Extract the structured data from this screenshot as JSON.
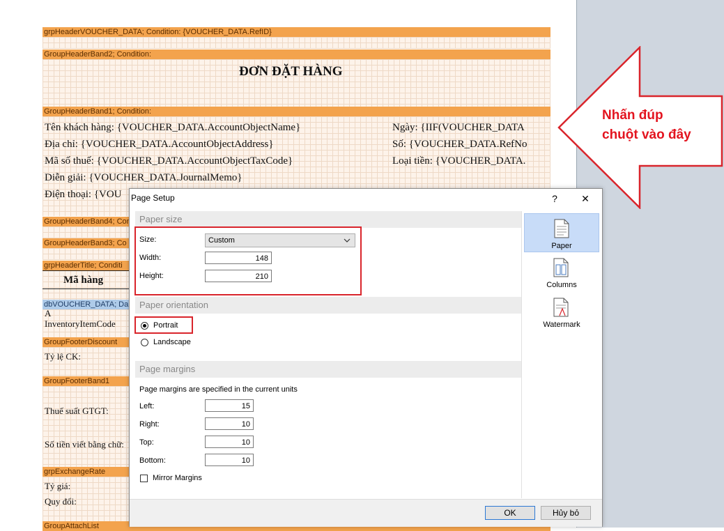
{
  "designer": {
    "bands": {
      "grp_header_voucher": "grpHeaderVOUCHER_DATA; Condition: {VOUCHER_DATA.RefID}",
      "group_header_band2": "GroupHeaderBand2; Condition:",
      "group_header_band1": "GroupHeaderBand1; Condition:",
      "group_header_band4": "GroupHeaderBand4; Cond",
      "group_header_band3": "GroupHeaderBand3; Co",
      "grp_header_title": "grpHeaderTitle; Conditi",
      "db_voucher_data": "dbVOUCHER_DATA; Da",
      "group_footer_discount": "GroupFooterDiscount",
      "group_footer_band1": "GroupFooterBand1",
      "grp_exchange_rate": "grpExchangeRate",
      "group_attach_list": "GroupAttachList"
    },
    "title": "ĐƠN ĐẶT HÀNG",
    "fields": {
      "customer_name": "Tên khách hàng:  {VOUCHER_DATA.AccountObjectName}",
      "address": "Địa chỉ:  {VOUCHER_DATA.AccountObjectAddress}",
      "tax_code": "Mã số thuế:   {VOUCHER_DATA.AccountObjectTaxCode}",
      "memo": "Diễn giải:  {VOUCHER_DATA.JournalMemo}",
      "phone": "Điện thoại:   {VOU",
      "date": "Ngày:   {IIF(VOUCHER_DATA",
      "ref_no": "Số:  {VOUCHER_DATA.RefNo",
      "currency": "Loại tiền:   {VOUCHER_DATA.",
      "item_code_header": "Mã hàng",
      "item_code_a": "A",
      "item_code_field": "InventoryItemCode",
      "discount_rate": "Tỷ lệ CK:",
      "vat_rate": "Thuế suất GTGT:",
      "amount_words": "Số tiền viết bằng chữ:",
      "exchange_rate": "Tỷ giá:",
      "converted": "Quy đổi:"
    }
  },
  "callout": {
    "line1": "Nhấn đúp",
    "line2": "chuột vào đây",
    "color": "#e3141f"
  },
  "dialog": {
    "title": "Page Setup",
    "help_label": "?",
    "close_label": "✕",
    "paper_size": {
      "heading": "Paper size",
      "size_label": "Size:",
      "size_value": "Custom",
      "width_label": "Width:",
      "width_value": "148",
      "height_label": "Height:",
      "height_value": "210"
    },
    "orientation": {
      "heading": "Paper orientation",
      "portrait_label": "Portrait",
      "landscape_label": "Landscape",
      "selected": "Portrait"
    },
    "margins": {
      "heading": "Page margins",
      "note": "Page margins are specified in the current units",
      "left_label": "Left:",
      "left_value": "15",
      "right_label": "Right:",
      "right_value": "10",
      "top_label": "Top:",
      "top_value": "10",
      "bottom_label": "Bottom:",
      "bottom_value": "10",
      "mirror_label": "Mirror Margins",
      "mirror_checked": false
    },
    "tabs": [
      {
        "label": "Paper",
        "icon": "paper-icon",
        "active": true
      },
      {
        "label": "Columns",
        "icon": "columns-icon",
        "active": false
      },
      {
        "label": "Watermark",
        "icon": "watermark-icon",
        "active": false
      }
    ],
    "ok_label": "OK",
    "cancel_label": "Hủy bỏ"
  }
}
